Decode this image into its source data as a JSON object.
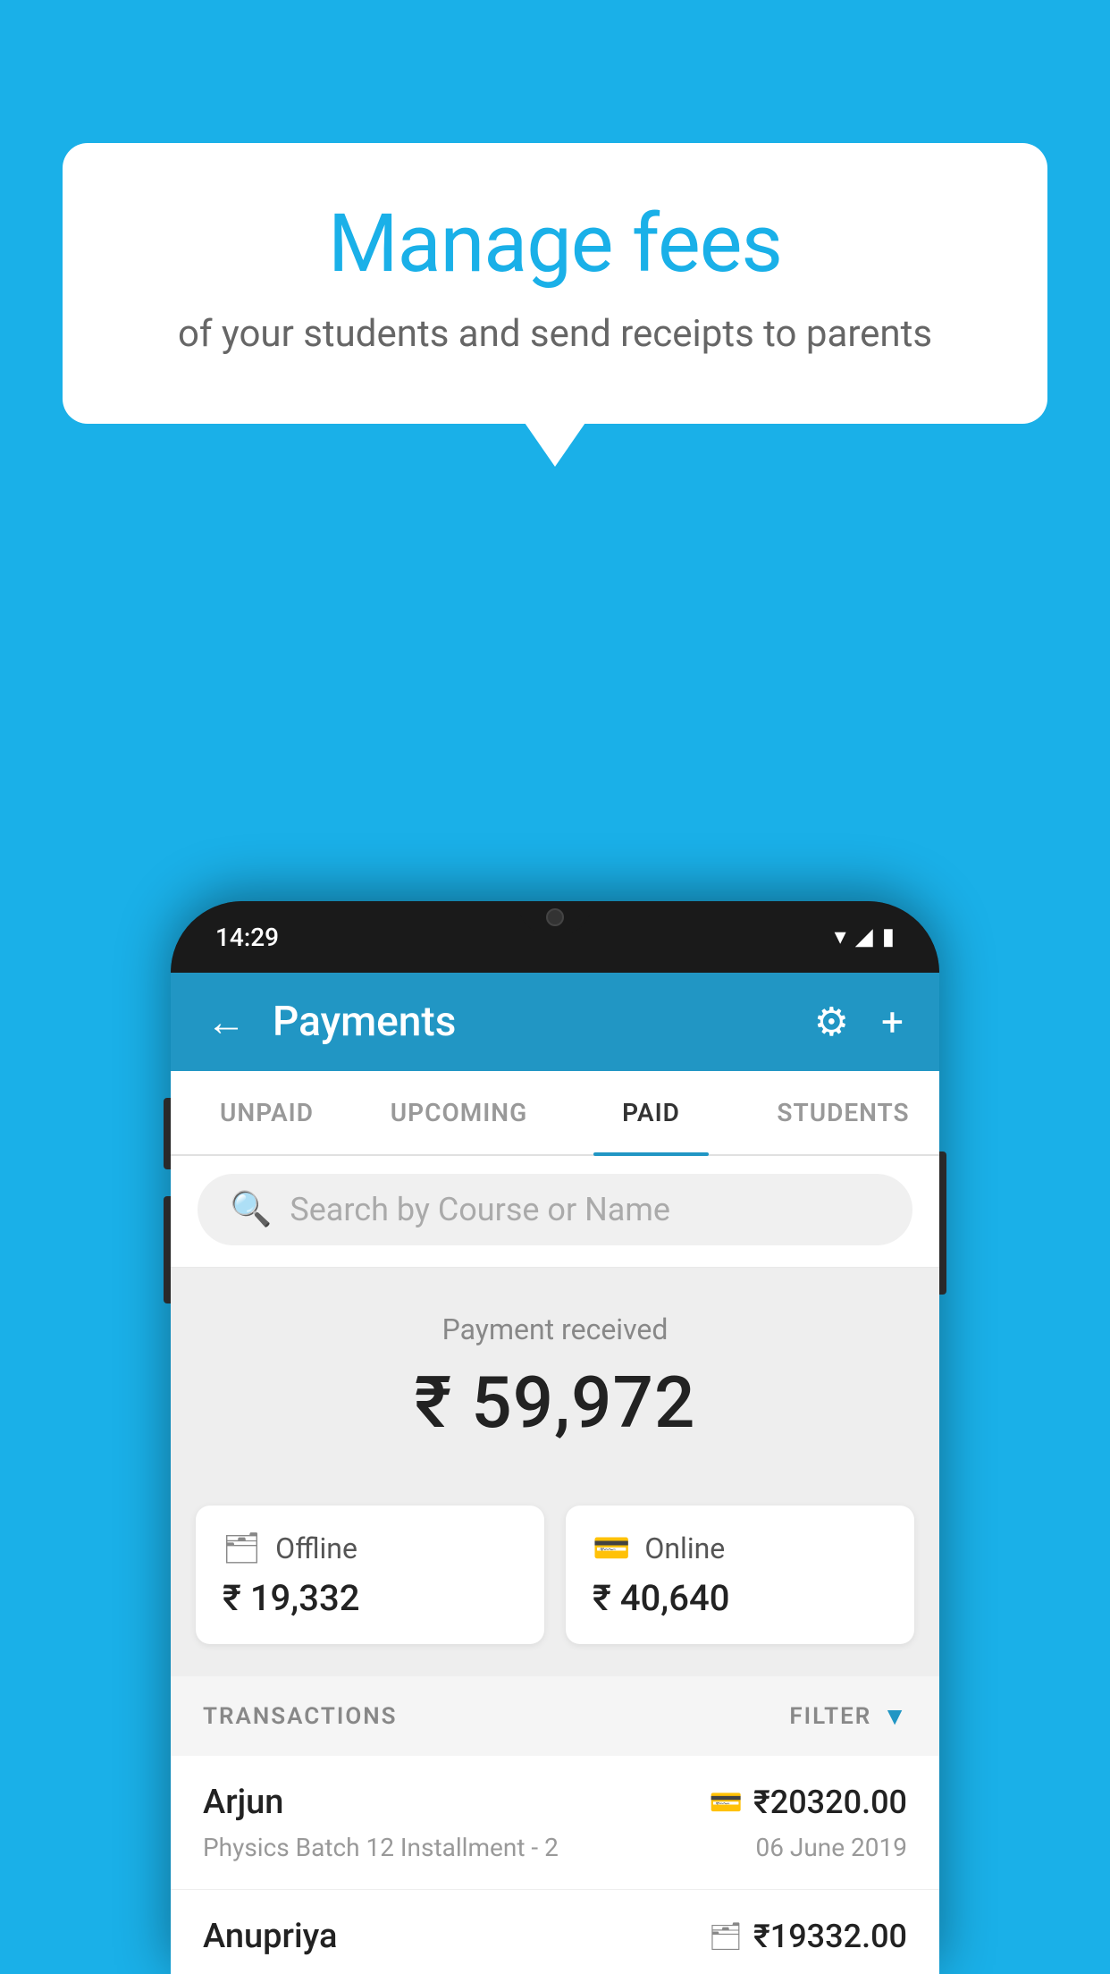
{
  "background_color": "#1ab0e8",
  "speech_bubble": {
    "title": "Manage fees",
    "subtitle": "of your students and send receipts to parents"
  },
  "phone": {
    "status_bar": {
      "time": "14:29",
      "wifi": "▼",
      "signal": "▲",
      "battery": "▮"
    },
    "header": {
      "back_label": "←",
      "title": "Payments",
      "settings_icon": "⚙",
      "add_icon": "+"
    },
    "tabs": [
      {
        "label": "UNPAID",
        "active": false
      },
      {
        "label": "UPCOMING",
        "active": false
      },
      {
        "label": "PAID",
        "active": true
      },
      {
        "label": "STUDENTS",
        "active": false
      }
    ],
    "search": {
      "placeholder": "Search by Course or Name"
    },
    "payment_received": {
      "label": "Payment received",
      "amount": "₹ 59,972"
    },
    "payment_cards": [
      {
        "type": "Offline",
        "amount": "₹ 19,332",
        "icon": "💳"
      },
      {
        "type": "Online",
        "amount": "₹ 40,640",
        "icon": "💳"
      }
    ],
    "transactions_label": "TRANSACTIONS",
    "filter_label": "FILTER",
    "transactions": [
      {
        "name": "Arjun",
        "amount": "₹20320.00",
        "description": "Physics Batch 12 Installment - 2",
        "date": "06 June 2019",
        "payment_type": "online"
      },
      {
        "name": "Anupriya",
        "amount": "₹19332.00",
        "description": "",
        "date": "",
        "payment_type": "offline"
      }
    ]
  }
}
